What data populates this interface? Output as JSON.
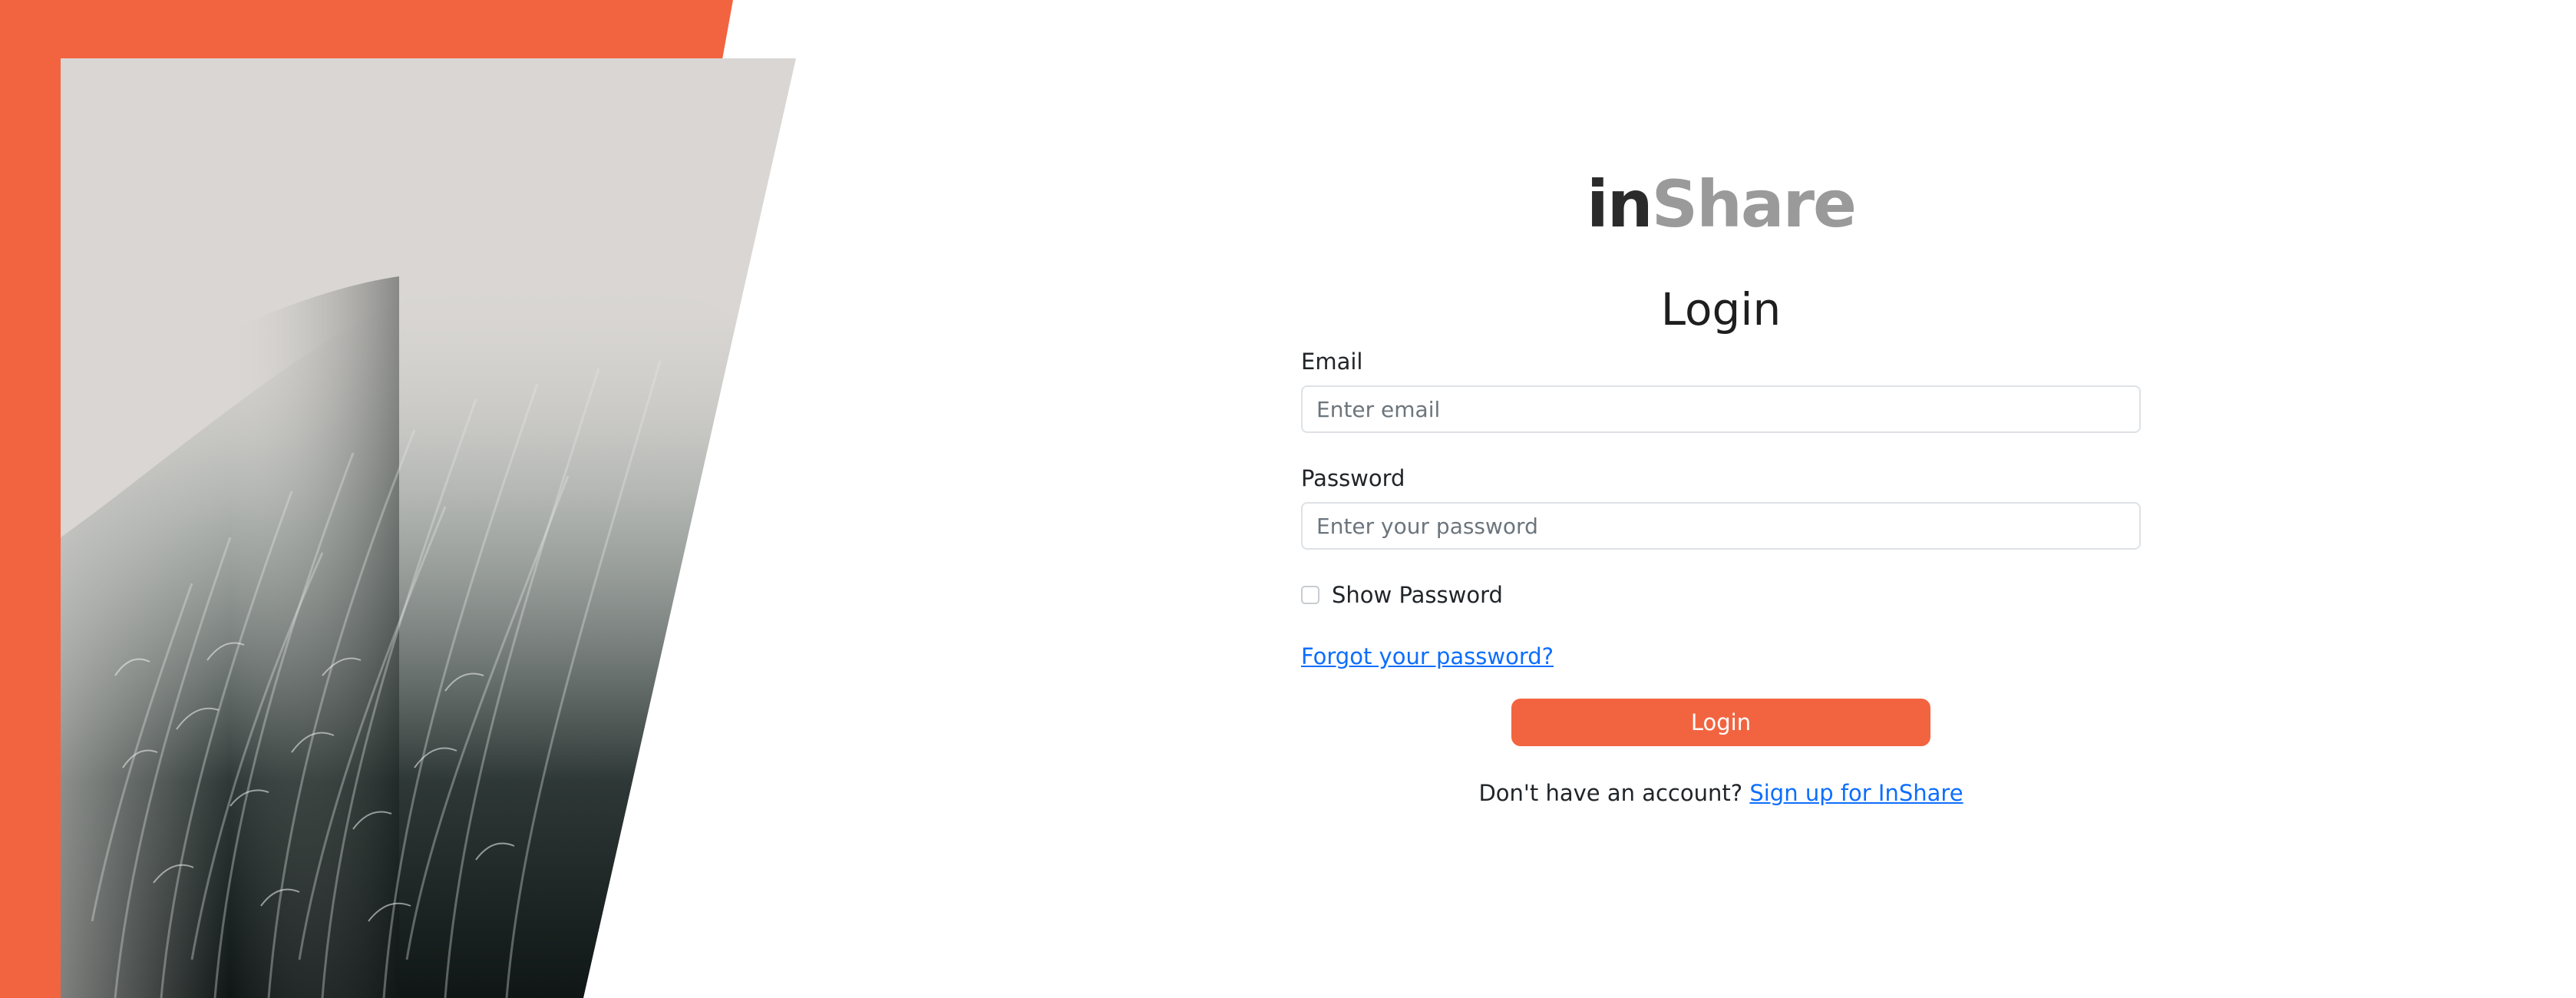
{
  "colors": {
    "accent": "#f26440",
    "link": "#0d6efd",
    "hero_bg": "#d9d6d3",
    "logo_dark": "#2b2b2b",
    "logo_light": "#9a9a9a"
  },
  "logo": {
    "part_dark": "in",
    "part_light": "Share"
  },
  "login": {
    "title": "Login",
    "email_label": "Email",
    "email_placeholder": "Enter email",
    "email_value": "",
    "password_label": "Password",
    "password_placeholder": "Enter your password",
    "password_value": "",
    "show_password_label": "Show Password",
    "show_password_checked": false,
    "forgot_link": "Forgot your password?",
    "submit_label": "Login",
    "signup_prompt": "Don't have an account?",
    "signup_link": "Sign up for InShare"
  }
}
